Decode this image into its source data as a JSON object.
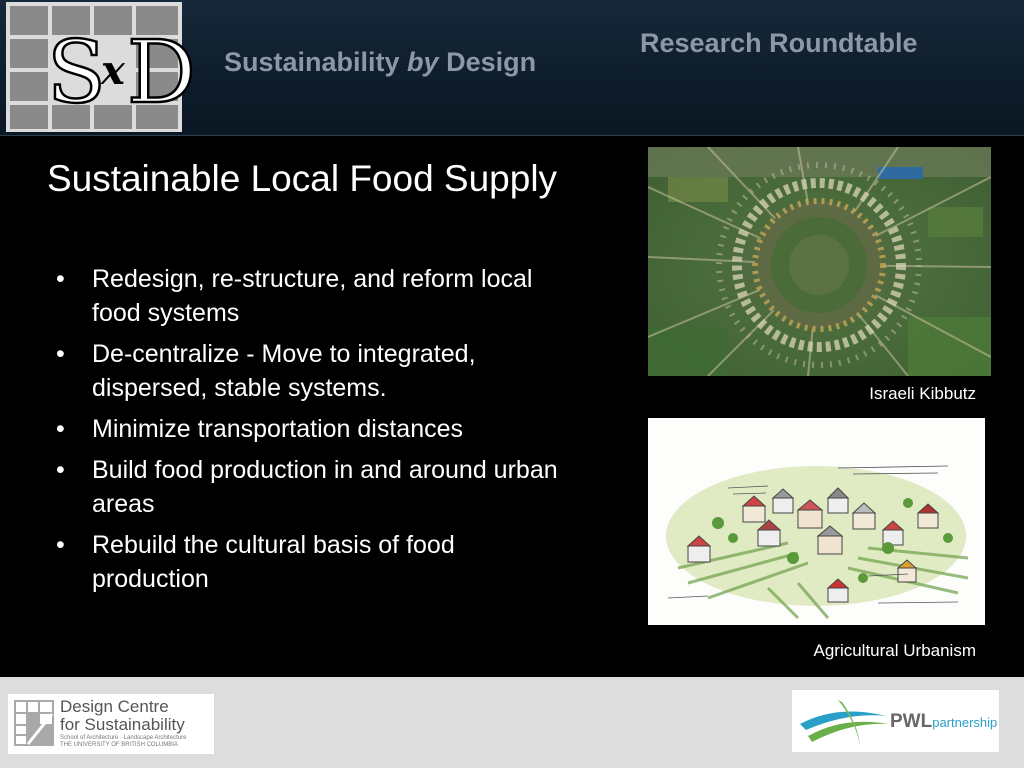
{
  "header": {
    "logo_text": "SxD",
    "subtitle_main": "Sustainability ",
    "subtitle_by": "by",
    "subtitle_end": " Design",
    "event": "Research Roundtable"
  },
  "slide": {
    "title": "Sustainable Local Food Supply",
    "bullets": [
      "Redesign, re-structure, and reform local food systems",
      "De-centralize -  Move  to integrated, dispersed, stable systems.",
      "Minimize transportation distances",
      "Build food production in and around urban areas",
      "Rebuild the cultural basis of food production"
    ],
    "bullet_glyph": "•"
  },
  "images": {
    "photo_caption": "Israeli  Kibbutz",
    "sketch_caption": "Agricultural Urbanism"
  },
  "footer": {
    "dcs_title_line1": "Design Centre",
    "dcs_title_line2": "for Sustainability",
    "dcs_sub_line1": "School of Architecture  ·  Landscape Architecture",
    "dcs_sub_line2": "THE UNIVERSITY OF BRITISH COLUMBIA",
    "pwl_main": "PWL",
    "pwl_partnership": "partnership"
  },
  "colors": {
    "header_bg": "#0e1d2b",
    "header_text": "#8a98a8",
    "body_bg": "#000000",
    "footer_bg": "#dddddd",
    "pwl_accent": "#2aa0c8"
  }
}
